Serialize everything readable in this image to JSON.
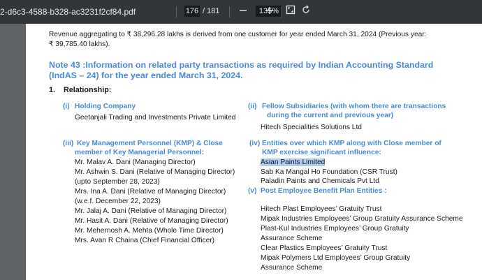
{
  "toolbar": {
    "filename": "2-d6c3-4588-b328-ac3231f2cf84.pdf",
    "current_page": "176",
    "total_pages": "/ 181",
    "zoom": "135%",
    "zoom_out_icon": "minus-icon",
    "zoom_in_icon": "plus-icon",
    "fit_icon": "fit-page-icon",
    "rotate_icon": "rotate-icon"
  },
  "document": {
    "revenue_line1": "Revenue aggregating to ₹ 38,296.28 lakhs is derived from one customer for year ended March 31, 2024 (Previous year:",
    "revenue_line2": "₹ 39,785.40 lakhs).",
    "note_line1": "Note 43 :Information on related party transactions as required by Indian Accounting Standard",
    "note_line2": "(IndAS – 24) for the year ended March 31, 2024.",
    "rel_num": "1.",
    "rel_title": "Relationship:",
    "holding_num": "(i)",
    "holding_title": "Holding Company",
    "holding_name": "Geetanjali Trading and Investments Private Limited",
    "fellow_num": "(ii)",
    "fellow_title1": "Fellow Subsidiaries (with whom there are transactions",
    "fellow_title2": "during the current and previous year)",
    "fellow_name": "Hitech Specialities Solutions Ltd",
    "kmp_num": "(iii)",
    "kmp_title1": "Key Management Personnel (KMP) & Close",
    "kmp_title2": "member of Key Managerial Personnel:",
    "kmp_people": [
      "Mr. Malav A. Dani (Managing Director)",
      "Mr. Ashwin S. Dani (Relative of Managing Director)",
      "(upto September 28, 2023)",
      "Mrs. Ina A. Dani (Relative of Managing Director)",
      "(w.e.f. December 22, 2023)",
      "Mr. Jalaj A. Dani (Relative of Managing Director)",
      "Mr. Hasit A. Dani (Relative of Managing Director)",
      "Mr. Mehernosh A. Mehta (Whole Time Director)",
      "Mrs. Avan R Chaina (Chief Financial Officer)"
    ],
    "ent_num": "(iv)",
    "ent_title1": "Entities over which KMP along with Close member of",
    "ent_title2": "KMP exercise significant influence:",
    "ent_names": [
      "Asian Paints Limited",
      "Sab Ka Mangal Ho Foundation (CSR Trust)",
      "Paladin Paints and Chemicals Pvt Ltd"
    ],
    "post_num": "(v)",
    "post_title": "Post Employee Benefit Plan Entities :",
    "post_names": [
      "Hitech Plast Employees’ Gratuity Trust",
      "Mipak Industries Employees’ Group Gratuity Assurance Scheme",
      "Plast-Kul Industries Employees’ Group Gratuity",
      "Assurance Scheme",
      "Clear Plastics Employees’ Gratuity Trust",
      "Mipak Polymers Ltd Employees’ Group Gratuity",
      "Assurance Scheme"
    ]
  }
}
